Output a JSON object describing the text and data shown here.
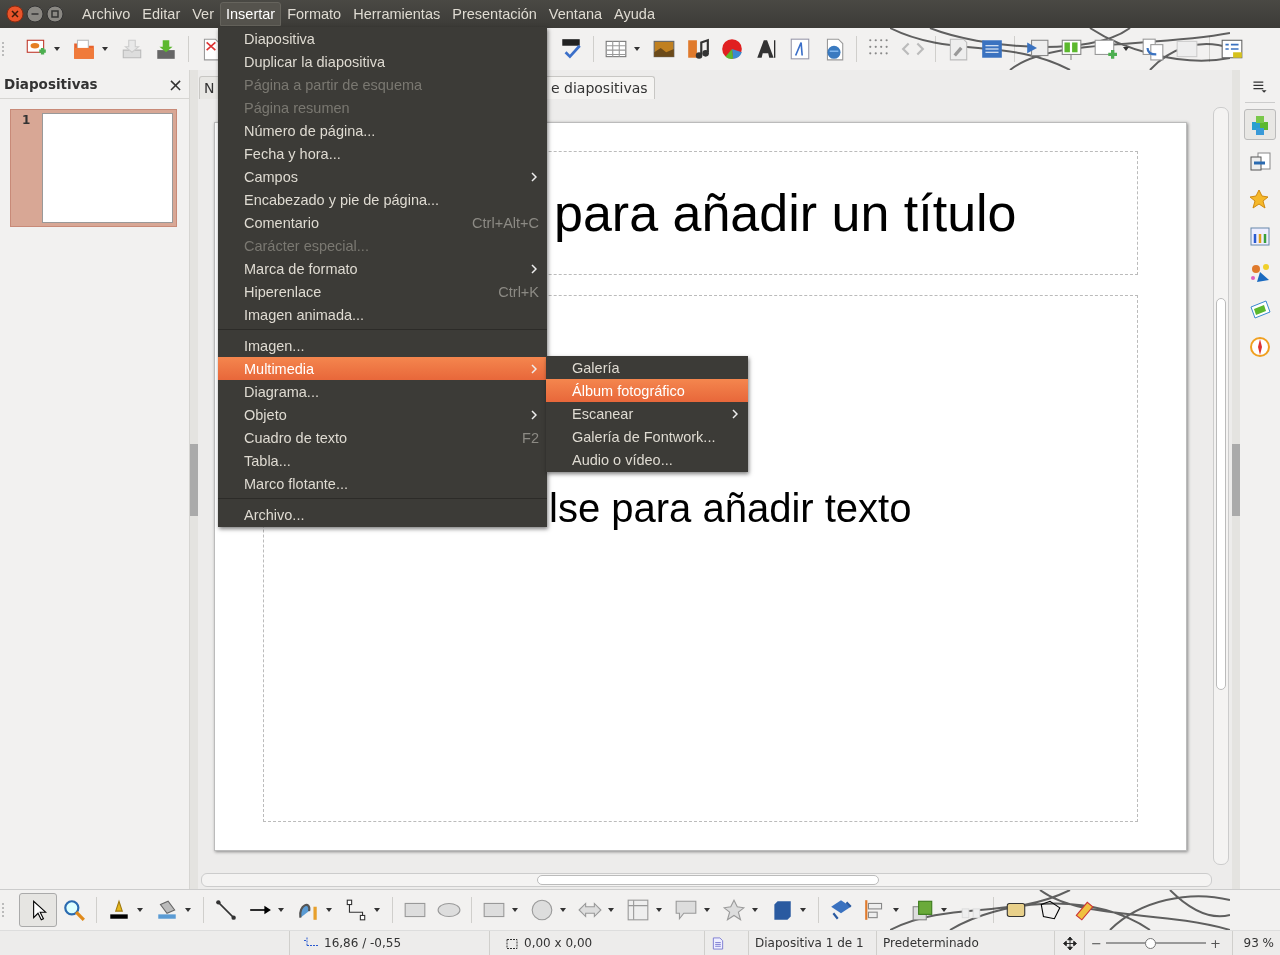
{
  "menu_bar": {
    "items": [
      {
        "label": "Archivo",
        "selected": false
      },
      {
        "label": "Editar",
        "selected": false
      },
      {
        "label": "Ver",
        "selected": false
      },
      {
        "label": "Insertar",
        "selected": true
      },
      {
        "label": "Formato",
        "selected": false
      },
      {
        "label": "Herramientas",
        "selected": false
      },
      {
        "label": "Presentación",
        "selected": false
      },
      {
        "label": "Ventana",
        "selected": false
      },
      {
        "label": "Ayuda",
        "selected": false
      }
    ]
  },
  "insert_menu": {
    "items": [
      {
        "kind": "item",
        "label": "Diapositiva",
        "disabled": false,
        "selected": false
      },
      {
        "kind": "item",
        "label": "Duplicar la diapositiva",
        "disabled": false,
        "selected": false
      },
      {
        "kind": "item",
        "label": "Página a partir de esquema",
        "disabled": true,
        "selected": false
      },
      {
        "kind": "item",
        "label": "Página resumen",
        "disabled": true,
        "selected": false
      },
      {
        "kind": "item",
        "label": "Número de página...",
        "disabled": false,
        "selected": false
      },
      {
        "kind": "item",
        "label": "Fecha y hora...",
        "disabled": false,
        "selected": false
      },
      {
        "kind": "submenu",
        "label": "Campos",
        "disabled": false,
        "selected": false
      },
      {
        "kind": "item",
        "label": "Encabezado y pie de página...",
        "disabled": false,
        "selected": false
      },
      {
        "kind": "item",
        "label": "Comentario",
        "shortcut": "Ctrl+Alt+C",
        "disabled": false,
        "selected": false
      },
      {
        "kind": "item",
        "label": "Carácter especial...",
        "disabled": true,
        "selected": false
      },
      {
        "kind": "submenu",
        "label": "Marca de formato",
        "disabled": false,
        "selected": false
      },
      {
        "kind": "item",
        "label": "Hiperenlace",
        "shortcut": "Ctrl+K",
        "disabled": false,
        "selected": false
      },
      {
        "kind": "item",
        "label": "Imagen animada...",
        "disabled": false,
        "selected": false
      },
      {
        "kind": "separator"
      },
      {
        "kind": "item",
        "label": "Imagen...",
        "disabled": false,
        "selected": false
      },
      {
        "kind": "submenu",
        "label": "Multimedia",
        "disabled": false,
        "selected": true
      },
      {
        "kind": "item",
        "label": "Diagrama...",
        "disabled": false,
        "selected": false
      },
      {
        "kind": "submenu",
        "label": "Objeto",
        "disabled": false,
        "selected": false
      },
      {
        "kind": "item",
        "label": "Cuadro de texto",
        "shortcut": "F2",
        "disabled": false,
        "selected": false
      },
      {
        "kind": "item",
        "label": "Tabla...",
        "disabled": false,
        "selected": false
      },
      {
        "kind": "item",
        "label": "Marco flotante...",
        "disabled": false,
        "selected": false
      },
      {
        "kind": "separator"
      },
      {
        "kind": "item",
        "label": "Archivo...",
        "disabled": false,
        "selected": false
      }
    ]
  },
  "multimedia_submenu": {
    "items": [
      {
        "kind": "item",
        "label": "Galería",
        "selected": false
      },
      {
        "kind": "item",
        "label": "Álbum fotográfico",
        "selected": true
      },
      {
        "kind": "submenu",
        "label": "Escanear",
        "selected": false
      },
      {
        "kind": "item",
        "label": "Galería de Fontwork...",
        "selected": false
      },
      {
        "kind": "item",
        "label": "Audio o vídeo...",
        "selected": false
      }
    ]
  },
  "slides_panel": {
    "title": "Diapositivas",
    "close": "×",
    "slides": [
      {
        "number": "1",
        "selected": true
      }
    ]
  },
  "view_tabs": [
    {
      "label": "N"
    },
    {
      "label": "e diapositivas"
    }
  ],
  "slide": {
    "title_placeholder": "para añadir un título",
    "content_placeholder": "lse para añadir texto"
  },
  "drawing_toolbar": {
    "select_tool": {
      "selected": true
    }
  },
  "sidebar": {
    "properties_deck": {
      "selected": true
    }
  },
  "status_bar": {
    "position": "16,86 / -0,55",
    "size": "0,00 x 0,00",
    "slide": "Diapositiva 1 de 1",
    "layout": "Predeterminado",
    "zoom_out": "−",
    "zoom_in": "+",
    "zoom": {
      "level": 0.43
    },
    "zoom_percent": "93 %"
  }
}
